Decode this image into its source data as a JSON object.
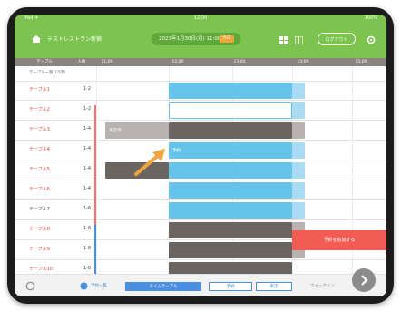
{
  "status": {
    "left": "iPad ✈",
    "center": "12:00",
    "right": "100%"
  },
  "nav": {
    "shop": "テストレストラン新宿",
    "date": "2023年1月30日(月) 11:00",
    "date_badge": "今日",
    "out_label": "ログアウト"
  },
  "grid": {
    "headers": [
      "テーブル",
      "人数",
      "11:00",
      "12:00",
      "13:00",
      "14:00",
      "15:00"
    ],
    "subheader": "テーブル一覧(15席)",
    "rows": [
      {
        "name": "テーブル1",
        "cap": "1-2"
      },
      {
        "name": "テーブル2",
        "cap": "1-2"
      },
      {
        "name": "テーブル3",
        "cap": "1-4"
      },
      {
        "name": "テーブル4",
        "cap": "1-4"
      },
      {
        "name": "テーブル5",
        "cap": "1-4"
      },
      {
        "name": "テーブル6",
        "cap": "1-4"
      },
      {
        "name": "テーブル7",
        "cap": "1-6"
      },
      {
        "name": "テーブル8",
        "cap": "1-6"
      },
      {
        "name": "テーブル9",
        "cap": "1-8"
      },
      {
        "name": "テーブル10",
        "cap": "1-8"
      }
    ],
    "booking_labels": [
      "予約",
      "来店済"
    ]
  },
  "bottom": {
    "left_icon_label": "予約一覧",
    "segments": [
      "タイムテーブル",
      "予約",
      "来店"
    ],
    "walkin": "ウォークイン"
  },
  "red_button": "予約を追加する",
  "colors": {
    "green": "#7cc44f",
    "blue": "#66c3ea",
    "gray": "#6b6562",
    "red": "#f25c54",
    "orange": "#f2a33a"
  }
}
